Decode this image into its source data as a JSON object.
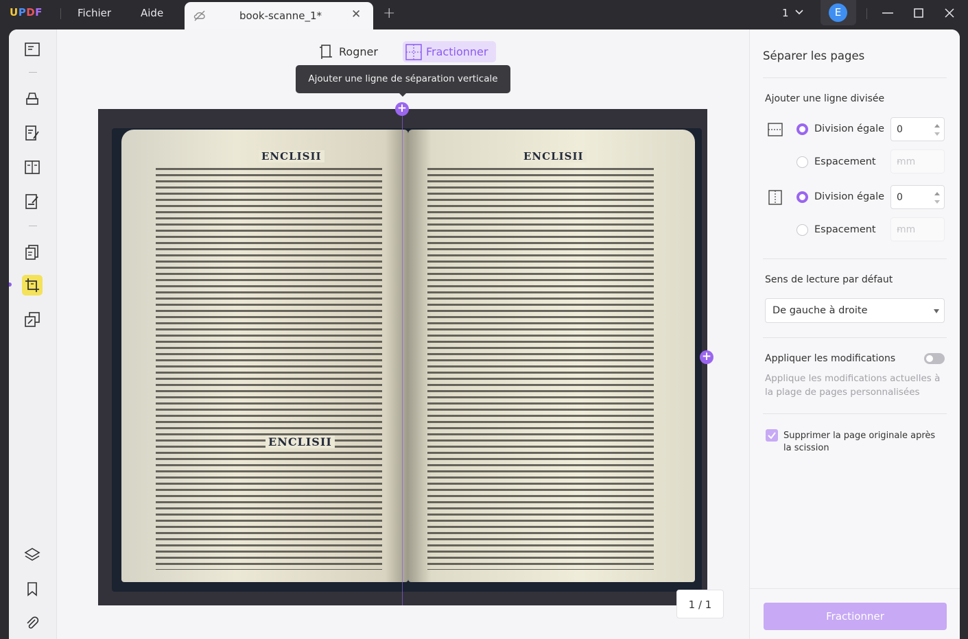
{
  "app": {
    "logo": "UPDF"
  },
  "menu": {
    "file": "Fichier",
    "help": "Aide"
  },
  "tab": {
    "title": "book-scanne_1*",
    "close": "✕",
    "add": "+"
  },
  "titlebar": {
    "page_count": "1",
    "avatar": "E"
  },
  "toolbar": {
    "crop": "Rogner",
    "split": "Fractionner",
    "tooltip": "Ajouter une ligne de séparation verticale"
  },
  "document": {
    "header_left": "ENCLISII",
    "header_right": "ENCLISII",
    "header_middle": "ENCLISII"
  },
  "page_indicator": "1 / 1",
  "panel": {
    "title": "Séparer les pages",
    "add_line_label": "Ajouter une ligne divisée",
    "horizontal": {
      "equal_label": "Division égale",
      "equal_value": "0",
      "spacing_label": "Espacement",
      "spacing_placeholder": "-",
      "spacing_unit": "mm"
    },
    "vertical": {
      "equal_label": "Division égale",
      "equal_value": "0",
      "spacing_label": "Espacement",
      "spacing_placeholder": "-",
      "spacing_unit": "mm"
    },
    "reading_label": "Sens de lecture par défaut",
    "reading_value": "De gauche à droite",
    "apply_label": "Appliquer les modifications",
    "apply_desc": "Applique les modifications actuelles à la plage de pages personnalisées",
    "delete_label": "Supprimer la page originale après la scission",
    "action": "Fractionner"
  },
  "colors": {
    "accent": "#9a66ef",
    "accent_light": "#e8dcfb",
    "active_tool": "#f4e25a"
  }
}
